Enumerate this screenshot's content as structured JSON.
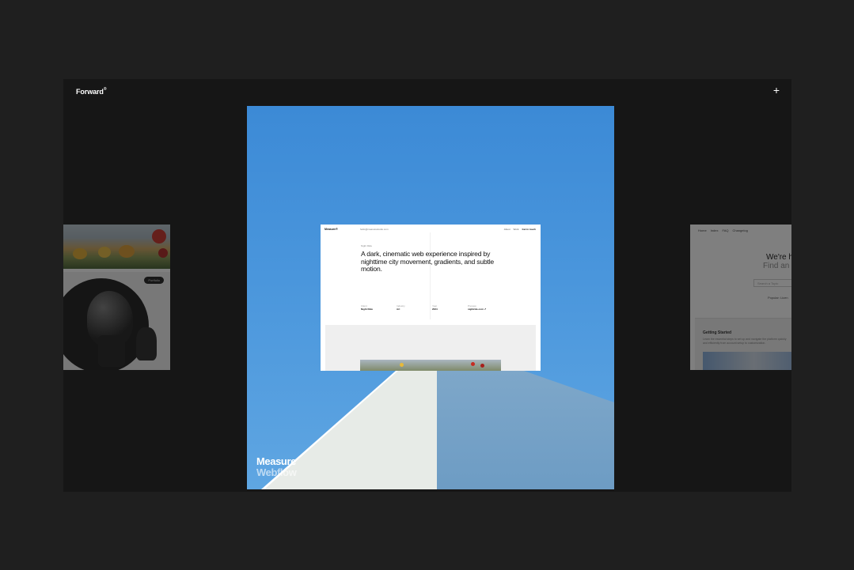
{
  "header": {
    "brand": "Forward",
    "brand_mark": "®",
    "add_icon": "+"
  },
  "center_card": {
    "title": "Measure",
    "subtitle": "Webflow",
    "site_preview": {
      "logo": "Measure®",
      "url": "hello@measurestudio.com",
      "nav": [
        "About",
        "Work",
        "Get in touch"
      ],
      "tag": "Night Ride",
      "headline": "A dark, cinematic web experience inspired by nighttime city movement, gradients, and subtle motion.",
      "meta": [
        {
          "label": "Client",
          "value": "Night Ride"
        },
        {
          "label": "Industry",
          "value": "Art"
        },
        {
          "label": "Year",
          "value": "2024"
        },
        {
          "label": "Preview",
          "value": "nightride.com ↗"
        }
      ]
    }
  },
  "left_card": {
    "pill": "Portfolio"
  },
  "right_card": {
    "nav": [
      "Home",
      "Index",
      "FAQ",
      "Changelog"
    ],
    "heading_1": "We're h",
    "heading_2": "Find an",
    "search_placeholder": "Search a Topic",
    "popular": "Popular: Licen",
    "box_title": "Getting Started",
    "box_text": "Learn the essential steps to set up and navigate the platform quickly and efficiently from account setup to customization."
  },
  "colors": {
    "background": "#1f1f1f",
    "stage": "#161616",
    "sky": "#4a96dc"
  }
}
